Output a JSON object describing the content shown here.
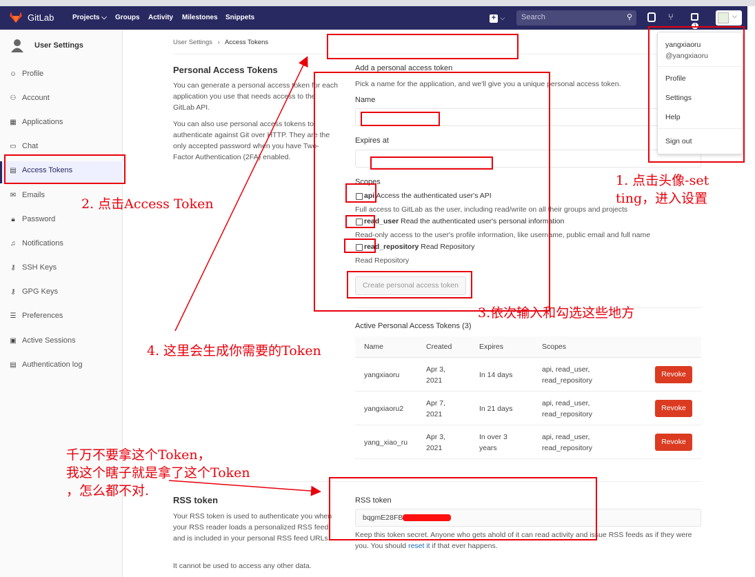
{
  "nav": {
    "logo_text": "GitLab",
    "items": [
      "Projects",
      "Groups",
      "Activity",
      "Milestones",
      "Snippets"
    ],
    "search_placeholder": "Search"
  },
  "sidebar": {
    "title": "User Settings",
    "items": [
      {
        "label": "Profile",
        "icon": "profile-icon"
      },
      {
        "label": "Account",
        "icon": "account-icon"
      },
      {
        "label": "Applications",
        "icon": "applications-icon"
      },
      {
        "label": "Chat",
        "icon": "chat-icon"
      },
      {
        "label": "Access Tokens",
        "icon": "access-tokens-icon"
      },
      {
        "label": "Emails",
        "icon": "email-icon"
      },
      {
        "label": "Password",
        "icon": "lock-icon"
      },
      {
        "label": "Notifications",
        "icon": "bell-icon"
      },
      {
        "label": "SSH Keys",
        "icon": "key-icon"
      },
      {
        "label": "GPG Keys",
        "icon": "key-icon"
      },
      {
        "label": "Preferences",
        "icon": "sliders-icon"
      },
      {
        "label": "Active Sessions",
        "icon": "monitor-icon"
      },
      {
        "label": "Authentication log",
        "icon": "log-icon"
      }
    ]
  },
  "breadcrumb": {
    "parent": "User Settings",
    "sep": "›",
    "current": "Access Tokens"
  },
  "pat_section": {
    "title": "Personal Access Tokens",
    "desc1": "You can generate a personal access token for each application you use that needs access to the GitLab API.",
    "desc2": "You can also use personal access tokens to authenticate against Git over HTTP. They are the only accepted password when you have Two-Factor Authentication (2FA) enabled."
  },
  "form": {
    "title": "Add a personal access token",
    "intro": "Pick a name for the application, and we'll give you a unique personal access token.",
    "name_label": "Name",
    "name_value": "",
    "expires_label": "Expires at",
    "expires_value": "",
    "scopes_label": "Scopes",
    "scopes": [
      {
        "name": "api",
        "desc": "Access the authenticated user's API",
        "help": "Full access to GitLab as the user, including read/write on all their groups and projects",
        "checked": false
      },
      {
        "name": "read_user",
        "desc": "Read the authenticated user's personal information",
        "help": "Read-only access to the user's profile information, like username, public email and full name",
        "checked": false
      },
      {
        "name": "read_repository",
        "desc": "Read Repository",
        "help": "Read Repository",
        "checked": false
      }
    ],
    "submit_label": "Create personal access token"
  },
  "active_tokens": {
    "title": "Active Personal Access Tokens (3)",
    "headers": [
      "Name",
      "Created",
      "Expires",
      "Scopes"
    ],
    "rows": [
      {
        "name": "yangxiaoru",
        "created": [
          "Apr 3,",
          "2021"
        ],
        "expires": [
          "In 14 days"
        ],
        "scopes": [
          "api, read_user,",
          "read_repository"
        ],
        "action": "Revoke"
      },
      {
        "name": "yangxiaoru2",
        "created": [
          "Apr 7,",
          "2021"
        ],
        "expires": [
          "In 21 days"
        ],
        "scopes": [
          "api, read_user,",
          "read_repository"
        ],
        "action": "Revoke"
      },
      {
        "name": "yang_xiao_ru",
        "created": [
          "Apr 3,",
          "2021"
        ],
        "expires": [
          "In over 3",
          "years"
        ],
        "scopes": [
          "api, read_user,",
          "read_repository"
        ],
        "action": "Revoke"
      }
    ]
  },
  "rss": {
    "title": "RSS token",
    "desc": "Your RSS token is used to authenticate you when your RSS reader loads a personalized RSS feed, and is included in your personal RSS feed URLs.",
    "desc2": "It cannot be used to access any other data.",
    "field_label": "RSS token",
    "token_visible": "bqgmE28FB",
    "help_prefix": "Keep this token secret. Anyone who gets ahold of it can read activity and issue RSS feeds as if they were you. You should ",
    "help_link": "reset it",
    "help_suffix": " if that ever happens."
  },
  "user_dropdown": {
    "name": "yangxiaoru",
    "handle": "@yangxiaoru",
    "items": [
      "Profile",
      "Settings",
      "Help",
      "Sign out"
    ]
  },
  "annotations": {
    "a1": "1. 点击头像-set\nting，进入设置",
    "a2": "2. 点击Access Token",
    "a3": "3.依次输入和勾选这些地方",
    "a4": "4. 这里会生成你需要的Token",
    "a5": "千万不要拿这个Token，\n我这个瞎子就是拿了这个Token\n，怎么都不对."
  },
  "colors": {
    "nav_bg": "#292961",
    "revoke": "#db3b21",
    "annotation": "#e8000b"
  }
}
